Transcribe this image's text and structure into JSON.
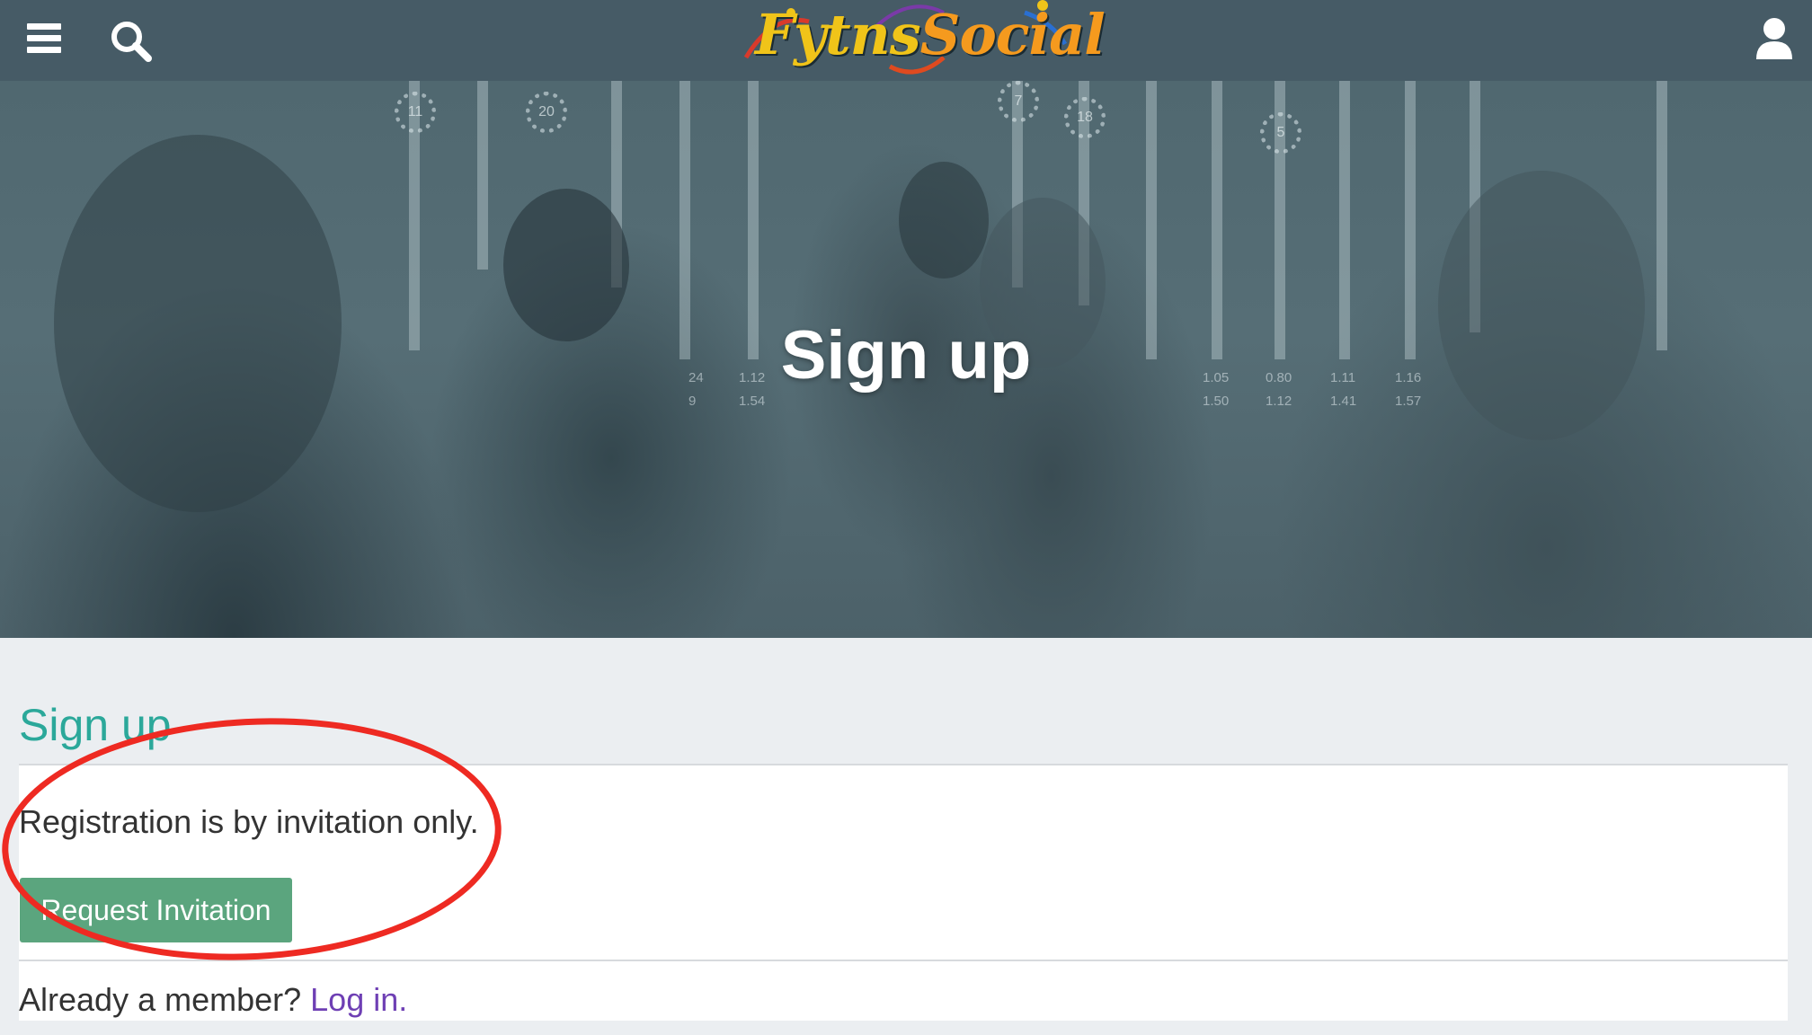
{
  "header": {
    "logo_text_fytns": "Fytns",
    "logo_text_social": "Social",
    "menu_icon": "hamburger-menu-icon",
    "search_icon": "search-icon",
    "user_icon": "user-icon",
    "background_color": "#465b66"
  },
  "hero": {
    "title": "Sign up",
    "rings": [
      "11",
      "20",
      "7",
      "18",
      "5"
    ],
    "metric_pairs": [
      [
        "24",
        "9"
      ],
      [
        "1.12",
        "1.54"
      ],
      [
        "1.05",
        "1.50"
      ],
      [
        "0.80",
        "1.12"
      ],
      [
        "1.11",
        "1.41"
      ],
      [
        "1.16",
        "1.57"
      ]
    ]
  },
  "content": {
    "section_title": "Sign up",
    "registration_text": "Registration is by invitation only.",
    "request_button_label": "Request Invitation",
    "already_member_text": "Already a member?",
    "login_link_label": "Log in.",
    "accent_color": "#2ba89a",
    "button_color": "#5ba57e",
    "link_color": "#6e3fb4",
    "annotation_color": "#ee2a22"
  }
}
